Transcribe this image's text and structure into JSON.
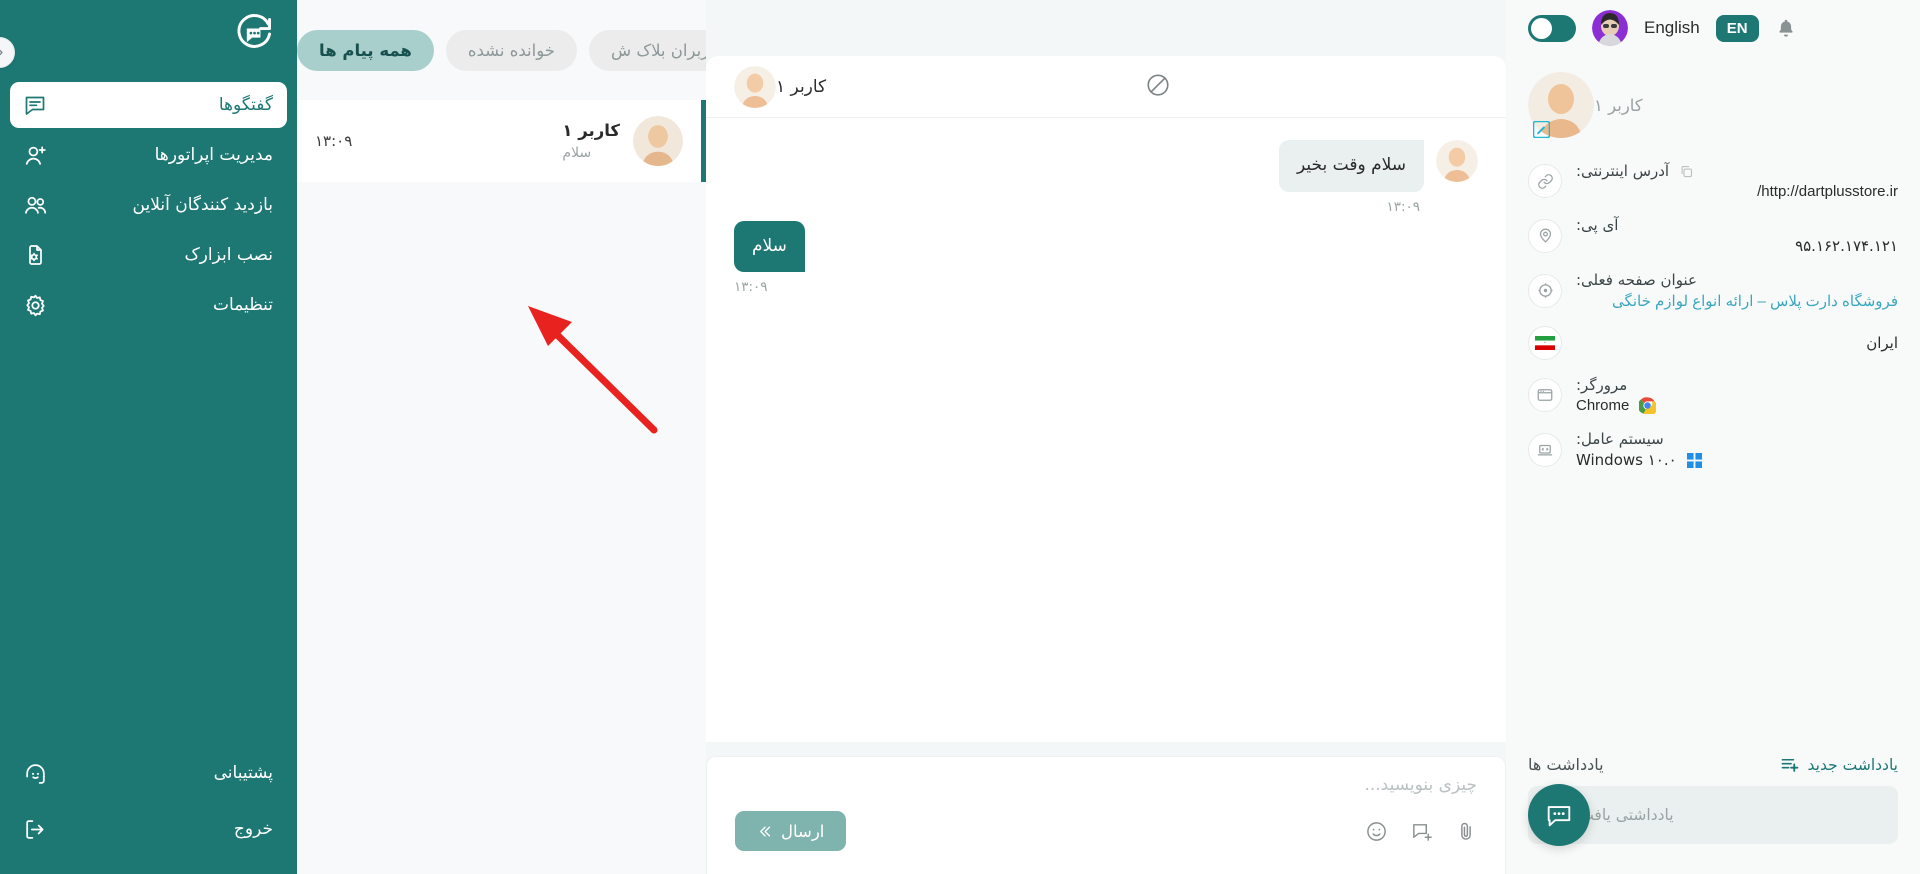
{
  "topbar": {
    "toggle_state": "on",
    "language_label": "English",
    "language_code": "EN",
    "bell_icon": "bell-icon"
  },
  "nav": {
    "logo_icon": "chat-logo-icon",
    "collapse_icon": "chevron-right-icon",
    "items": [
      {
        "label": "گفتگوها",
        "icon": "chat-bubble-icon",
        "active": true
      },
      {
        "label": "مدیریت اپراتورها",
        "icon": "user-plus-icon",
        "active": false
      },
      {
        "label": "بازدید کنندگان آنلاین",
        "icon": "users-icon",
        "active": false
      },
      {
        "label": "نصب ابزارک",
        "icon": "file-gear-icon",
        "active": false
      },
      {
        "label": "تنظیمات",
        "icon": "gear-icon",
        "active": false
      }
    ],
    "bottom_items": [
      {
        "label": "پشتیبانی",
        "icon": "support-headset-icon"
      },
      {
        "label": "خروج",
        "icon": "logout-icon"
      }
    ]
  },
  "conversations": {
    "filters": [
      {
        "label": "همه پیام ها",
        "active": true
      },
      {
        "label": "خوانده نشده",
        "active": false
      },
      {
        "label": "کاربران بلاک ش",
        "active": false
      }
    ],
    "items": [
      {
        "name": "کاربر ۱",
        "snippet": "سلام",
        "time": "۱۳:۰۹",
        "selected": true
      }
    ]
  },
  "chat": {
    "header": {
      "name": "کاربر ۱",
      "block_icon": "block-icon"
    },
    "messages": [
      {
        "direction": "incoming",
        "text": "سلام وقت بخیر",
        "time": "۱۳:۰۹"
      },
      {
        "direction": "outgoing",
        "text": "سلام",
        "time": "۱۳:۰۹"
      }
    ],
    "composer": {
      "placeholder": "چیزی بنویسید...",
      "value": "",
      "send_label": "ارسال",
      "tools": [
        {
          "icon": "emoji-icon"
        },
        {
          "icon": "canned-response-icon"
        },
        {
          "icon": "attachment-icon"
        }
      ]
    }
  },
  "visitor": {
    "name": "کاربر ۱",
    "edit_icon": "edit-icon",
    "rows": [
      {
        "icon": "link-icon",
        "label": "آدرس اینترنتی:",
        "value": "http://dartplusstore.ir/",
        "value_style": "ltr",
        "has_copy": true
      },
      {
        "icon": "location-pin-icon",
        "label": "آی پی:",
        "value": "۹۵.۱۶۲.۱۷۴.۱۲۱",
        "value_style": "fa",
        "has_copy": false
      },
      {
        "icon": "target-icon",
        "label": "عنوان صفحه فعلی:",
        "value": "فروشگاه دارت پلاس – ارائه انواع لوازم خانگی",
        "value_style": "link",
        "has_copy": false
      }
    ],
    "country": {
      "icon": "iran-flag-icon",
      "label": "ایران"
    },
    "browser": {
      "icon": "browser-icon",
      "label": "مرورگر:",
      "value": "Chrome",
      "glyph": "chrome-icon"
    },
    "os": {
      "icon": "laptop-icon",
      "label": "سیستم عامل:",
      "value": "Windows ۱۰.۰",
      "glyph": "windows-icon"
    }
  },
  "notes": {
    "title": "یادداشت ها",
    "new_label": "یادداشت جدید",
    "new_icon": "note-add-icon",
    "empty_text": "یادداشتی یافت نشد"
  },
  "fab": {
    "icon": "chat-fab-icon"
  },
  "colors": {
    "brand_teal": "#1d7874",
    "chip_active": "#a8cfcb",
    "send_button": "#7fb3ae",
    "link_blue": "#3aa7bd",
    "annotation_red": "#e8231f"
  }
}
